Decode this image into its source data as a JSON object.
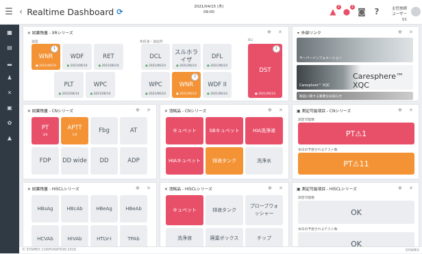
{
  "header": {
    "title": "Realtime Dashboard",
    "datetime_line1": "2021/04/15 (木)",
    "datetime_line2": "09:00",
    "badge_count_1": "2",
    "badge_count_2": "1",
    "user_line1": "主任技師",
    "user_line2": "ユーザー01"
  },
  "footer": {
    "copyright": "© SYSMEX CORPORATION 2016",
    "brand": "SYSMEX"
  },
  "panels": {
    "xr": {
      "title": "試薬残量",
      "series": " - XRシリーズ",
      "groups": [
        "凝固",
        "免疫凝・凝血剤",
        "RU"
      ],
      "tiles": [
        {
          "label": "WNR",
          "date": "2021/06/14",
          "num": "1"
        },
        {
          "label": "WDF",
          "date": "2021/06/14"
        },
        {
          "label": "RET",
          "date": "2021/06/14"
        },
        {
          "label": "PLT",
          "date": "2021/06/14"
        },
        {
          "label": "WPC",
          "date": "2021/06/14"
        },
        {
          "label": "DCL",
          "date": "2021/06/14"
        },
        {
          "label": "スルホラ\nイザ",
          "date": "2021/06/14"
        },
        {
          "label": "DFL",
          "date": "2021/06/14"
        },
        {
          "label": "WPC",
          "date": "2021/06/14"
        },
        {
          "label": "WNR",
          "date": "2021/06/14",
          "num": "2"
        },
        {
          "label": "WDF II",
          "date": "2021/06/14"
        },
        {
          "label": "DST",
          "date": "2021/06/14",
          "num": "1"
        }
      ]
    },
    "links": {
      "title": "外部リンク",
      "caption1": "サーバーインフォメーション",
      "caption2": "Caresphere™ XQC",
      "caption3": "製品に関する重要なお知らせ",
      "brand": "Caresphere™ XQC"
    },
    "cn_reagent": {
      "title": "試薬残量",
      "series": " - CNシリーズ",
      "tiles": [
        {
          "label": "PT",
          "sub": "3/4"
        },
        {
          "label": "APTT",
          "sub": "1/4"
        },
        {
          "label": "Fbg"
        },
        {
          "label": "AT"
        },
        {
          "label": "FDP"
        },
        {
          "label": "DD wide"
        },
        {
          "label": "DD"
        },
        {
          "label": "ADP"
        }
      ]
    },
    "cn_supply": {
      "title": "消耗品",
      "series": " - CNシリーズ",
      "tiles": [
        {
          "label": "キュベット"
        },
        {
          "label": "SBキュベット"
        },
        {
          "label": "HIA洗浄液"
        },
        {
          "label": "HIAキュベット"
        },
        {
          "label": "排液タンク"
        },
        {
          "label": "洗浄水"
        }
      ]
    },
    "cn_measure": {
      "title": "測定可能項目",
      "series": " - CNシリーズ",
      "label1": "測定可能数",
      "status1": "PT ",
      "count1": "1",
      "label2": "本日の予想されるテスト数",
      "status2": "PT ",
      "count2": "11"
    },
    "hiscl_reagent": {
      "title": "試薬残量",
      "series": " - HISCLシリーズ",
      "tiles": [
        {
          "label": "HBsAg"
        },
        {
          "label": "HBcAb"
        },
        {
          "label": "HBeAg"
        },
        {
          "label": "HBeAb"
        },
        {
          "label": "HCVAb"
        },
        {
          "label": "HIVAb"
        },
        {
          "label": "HTLV-I"
        },
        {
          "label": "TPAb"
        }
      ]
    },
    "hiscl_supply": {
      "title": "消耗品",
      "series": " - HISCLシリーズ",
      "tiles": [
        {
          "label": "キュベット"
        },
        {
          "label": "排液タンク"
        },
        {
          "label": "プローブウォ\nッシャー"
        },
        {
          "label": "洗浄液"
        },
        {
          "label": "廃棄ボックス"
        },
        {
          "label": "チップ"
        }
      ]
    },
    "hiscl_measure": {
      "title": "測定可能項目",
      "series": " - HISCLシリーズ",
      "label1": "測定可能数",
      "status1": "OK",
      "label2": "本日の予想されるテスト数",
      "status2": "OK"
    }
  },
  "colors": {
    "red": "#e8506a",
    "orange": "#f39335",
    "gray": "#ebedf0",
    "sidebar": "#2f3a44",
    "accent": "#1a73c8"
  }
}
